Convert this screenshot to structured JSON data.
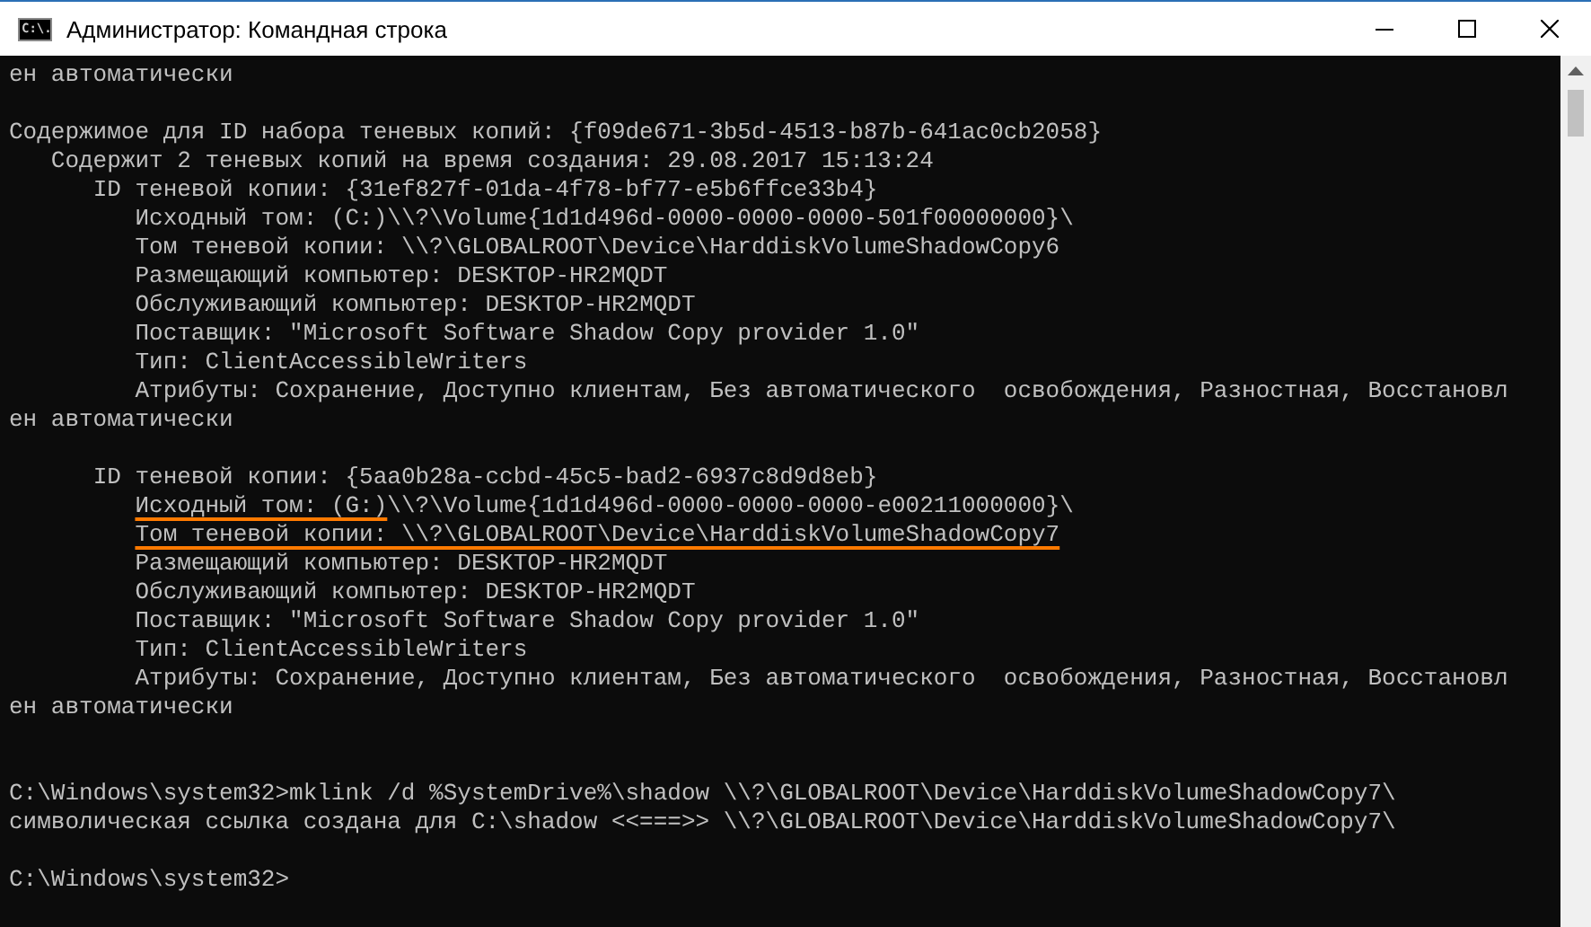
{
  "window": {
    "title": "Администратор: Командная строка",
    "icon_text": "C:\\."
  },
  "console": {
    "lines": [
      {
        "kind": "text",
        "text": "ен автоматически",
        "underlined": false
      },
      {
        "kind": "blank"
      },
      {
        "kind": "text",
        "text": "Содержимое для ID набора теневых копий: {f09de671-3b5d-4513-b87b-641ac0cb2058}",
        "underlined": false
      },
      {
        "kind": "text",
        "text": "   Содержит 2 теневых копий на время создания: 29.08.2017 15:13:24",
        "underlined": false
      },
      {
        "kind": "text",
        "text": "      ID теневой копии: {31ef827f-01da-4f78-bf77-e5b6ffce33b4}",
        "underlined": false
      },
      {
        "kind": "text",
        "text": "         Исходный том: (C:)\\\\?\\Volume{1d1d496d-0000-0000-0000-501f00000000}\\",
        "underlined": false
      },
      {
        "kind": "text",
        "text": "         Том теневой копии: \\\\?\\GLOBALROOT\\Device\\HarddiskVolumeShadowCopy6",
        "underlined": false
      },
      {
        "kind": "text",
        "text": "         Размещающий компьютер: DESKTOP-HR2MQDT",
        "underlined": false
      },
      {
        "kind": "text",
        "text": "         Обслуживающий компьютер: DESKTOP-HR2MQDT",
        "underlined": false
      },
      {
        "kind": "text",
        "text": "         Поставщик: \"Microsoft Software Shadow Copy provider 1.0\"",
        "underlined": false
      },
      {
        "kind": "text",
        "text": "         Тип: ClientAccessibleWriters",
        "underlined": false
      },
      {
        "kind": "text",
        "text": "         Атрибуты: Сохранение, Доступно клиентам, Без автоматического  освобождения, Разностная, Восстановл",
        "underlined": false
      },
      {
        "kind": "text",
        "text": "ен автоматически",
        "underlined": false
      },
      {
        "kind": "blank"
      },
      {
        "kind": "text",
        "text": "      ID теневой копии: {5aa0b28a-ccbd-45c5-bad2-6937c8d9d8eb}",
        "underlined": false
      },
      {
        "kind": "text",
        "text": "         Исходный том: (G:)",
        "underlined": true,
        "rest": "\\\\?\\Volume{1d1d496d-0000-0000-0000-e00211000000}\\"
      },
      {
        "kind": "text",
        "text": "         Том теневой копии: \\\\?\\GLOBALROOT\\Device\\HarddiskVolumeShadowCopy7",
        "underlined": true
      },
      {
        "kind": "text",
        "text": "         Размещающий компьютер: DESKTOP-HR2MQDT",
        "underlined": false
      },
      {
        "kind": "text",
        "text": "         Обслуживающий компьютер: DESKTOP-HR2MQDT",
        "underlined": false
      },
      {
        "kind": "text",
        "text": "         Поставщик: \"Microsoft Software Shadow Copy provider 1.0\"",
        "underlined": false
      },
      {
        "kind": "text",
        "text": "         Тип: ClientAccessibleWriters",
        "underlined": false
      },
      {
        "kind": "text",
        "text": "         Атрибуты: Сохранение, Доступно клиентам, Без автоматического  освобождения, Разностная, Восстановл",
        "underlined": false
      },
      {
        "kind": "text",
        "text": "ен автоматически",
        "underlined": false
      },
      {
        "kind": "blank"
      },
      {
        "kind": "blank"
      },
      {
        "kind": "text",
        "text": "C:\\Windows\\system32>mklink /d %SystemDrive%\\shadow \\\\?\\GLOBALROOT\\Device\\HarddiskVolumeShadowCopy7\\",
        "underlined": false
      },
      {
        "kind": "text",
        "text": "символическая ссылка создана для C:\\shadow <<===>> \\\\?\\GLOBALROOT\\Device\\HarddiskVolumeShadowCopy7\\",
        "underlined": false
      },
      {
        "kind": "blank"
      },
      {
        "kind": "text",
        "text": "C:\\Windows\\system32>",
        "underlined": false
      }
    ]
  }
}
